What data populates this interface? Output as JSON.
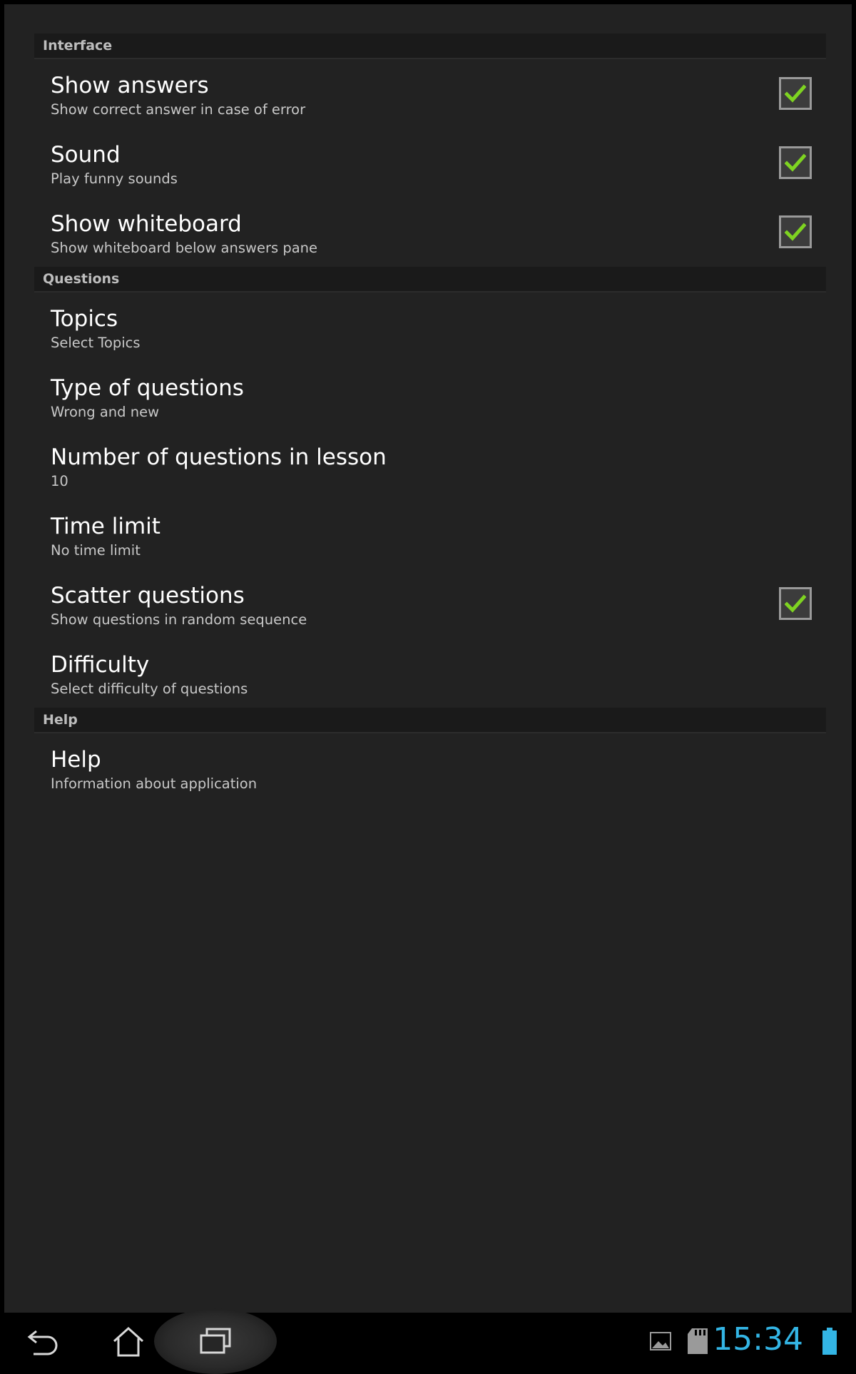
{
  "sections": [
    {
      "header": "Interface",
      "items": [
        {
          "title": "Show answers",
          "summary": "Show correct answer in case of error",
          "checked": true
        },
        {
          "title": "Sound",
          "summary": "Play funny sounds",
          "checked": true
        },
        {
          "title": "Show whiteboard",
          "summary": "Show whiteboard below answers pane",
          "checked": true
        }
      ]
    },
    {
      "header": "Questions",
      "items": [
        {
          "title": "Topics",
          "summary": "Select Topics"
        },
        {
          "title": "Type of questions",
          "summary": "Wrong and new"
        },
        {
          "title": "Number of questions in lesson",
          "summary": "10"
        },
        {
          "title": "Time limit",
          "summary": "No time limit"
        },
        {
          "title": "Scatter questions",
          "summary": "Show questions in random sequence",
          "checked": true
        },
        {
          "title": "Difficulty",
          "summary": "Select difficulty of questions"
        }
      ]
    },
    {
      "header": "Help",
      "items": [
        {
          "title": "Help",
          "summary": "Information about application"
        }
      ]
    }
  ],
  "status_bar": {
    "time": "15:34",
    "icons": [
      "gallery-icon",
      "sd-card-icon",
      "battery-icon"
    ]
  },
  "nav_bar": {
    "buttons": [
      "back-icon",
      "home-icon",
      "recent-apps-icon"
    ]
  },
  "colors": {
    "background": "#222222",
    "header_bg": "#1a1a1a",
    "check": "#7ed321",
    "clock": "#33b5e5"
  }
}
